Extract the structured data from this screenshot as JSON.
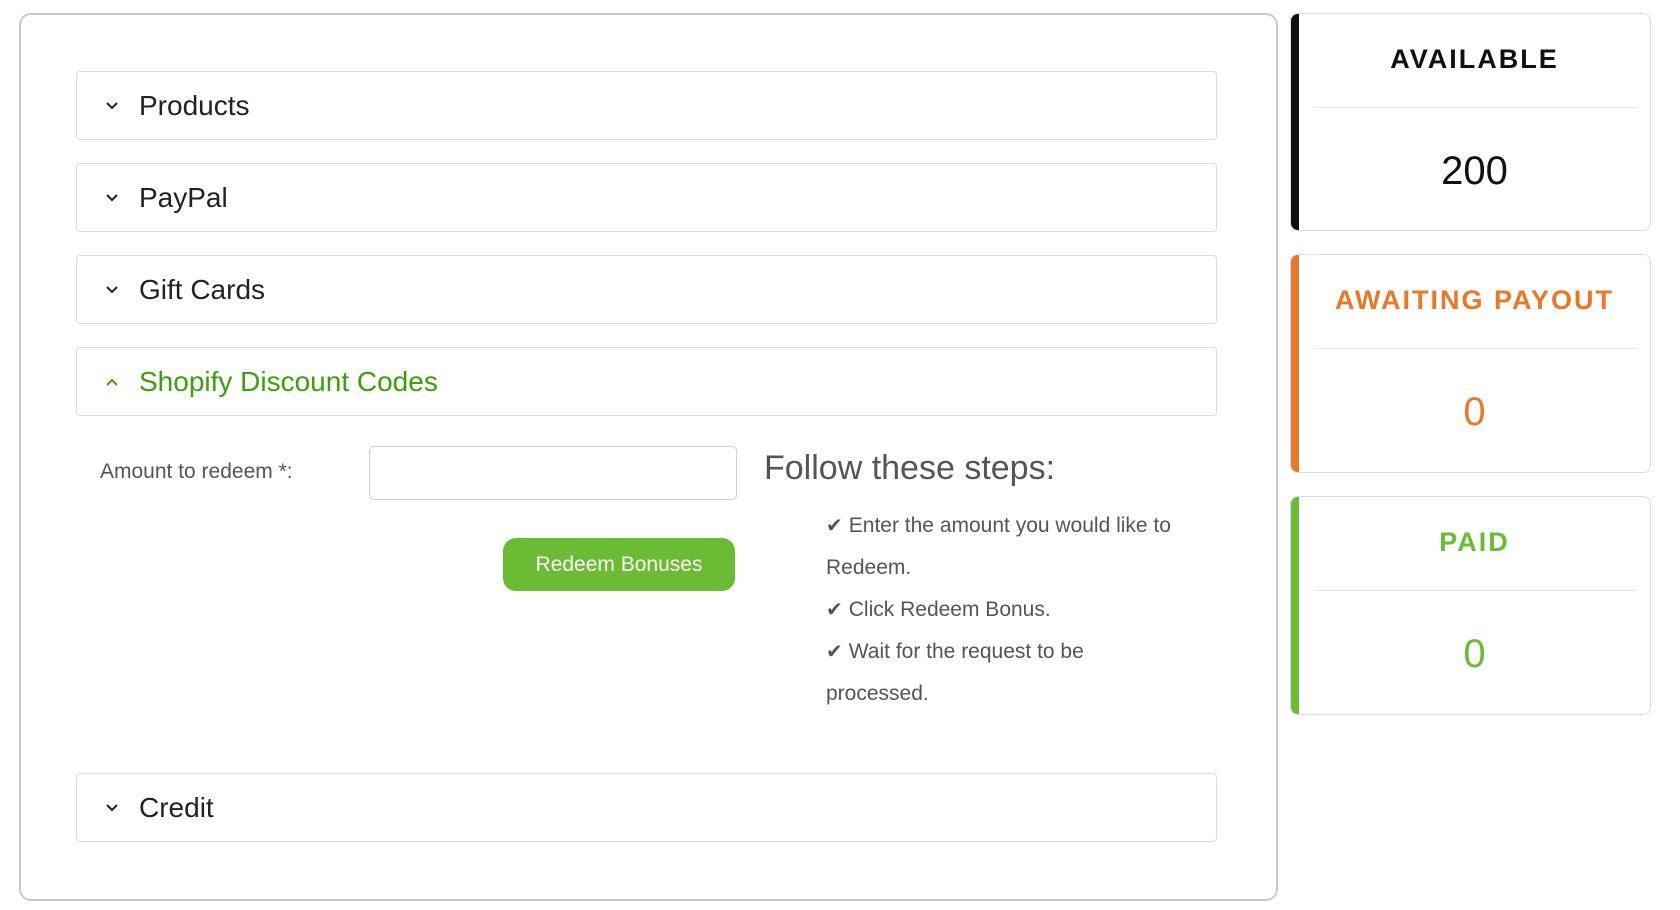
{
  "accordion": {
    "items": [
      {
        "label": "Products",
        "expanded": false
      },
      {
        "label": "PayPal",
        "expanded": false
      },
      {
        "label": "Gift Cards",
        "expanded": false
      },
      {
        "label": "Shopify Discount Codes",
        "expanded": true
      },
      {
        "label": "Credit",
        "expanded": false
      }
    ]
  },
  "redeem_form": {
    "amount_label": "Amount to redeem *:",
    "amount_value": "",
    "button_label": "Redeem Bonuses"
  },
  "steps": {
    "title": "Follow these steps:",
    "items": [
      "Enter the amount you would like to Redeem.",
      "Click Redeem Bonus.",
      "Wait for the request to be processed."
    ]
  },
  "stats": [
    {
      "title": "AVAILABLE",
      "value": "200",
      "color": "#111111"
    },
    {
      "title": "AWAITING PAYOUT",
      "value": "0",
      "color": "#e8792b"
    },
    {
      "title": "PAID",
      "value": "0",
      "color": "#6cbb35"
    }
  ],
  "colors": {
    "active": "#3c9d0e",
    "button": "#6cbb35"
  },
  "icons": {
    "collapsed": "chevron-down-icon",
    "expanded": "chevron-up-icon",
    "step": "check-icon"
  }
}
